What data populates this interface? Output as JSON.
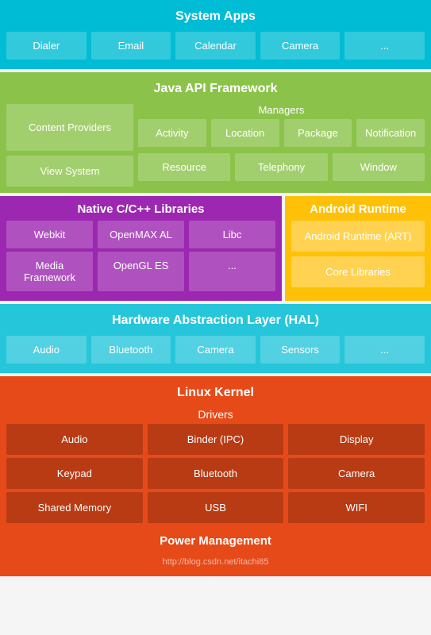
{
  "systemApps": {
    "title": "System Apps",
    "items": [
      "Dialer",
      "Email",
      "Calendar",
      "Camera",
      "..."
    ]
  },
  "javaAPI": {
    "title": "Java API Framework",
    "contentProviders": "Content Providers",
    "viewSystem": "View System",
    "managersTitle": "Managers",
    "managersRow1": [
      "Activity",
      "Location",
      "Package",
      "Notification"
    ],
    "managersRow2": [
      "Resource",
      "Telephony",
      "Window"
    ]
  },
  "nativeCpp": {
    "title": "Native C/C++ Libraries",
    "row1": [
      "Webkit",
      "OpenMAX AL",
      "Libc"
    ],
    "row2": [
      "Media Framework",
      "OpenGL ES",
      "..."
    ]
  },
  "androidRuntime": {
    "title": "Android Runtime",
    "item1": "Android Runtime (ART)",
    "item2": "Core Libraries"
  },
  "hal": {
    "title": "Hardware Abstraction Layer (HAL)",
    "items": [
      "Audio",
      "Bluetooth",
      "Camera",
      "Sensors",
      "..."
    ]
  },
  "linuxKernel": {
    "title": "Linux Kernel",
    "driversTitle": "Drivers",
    "row1": [
      "Audio",
      "Binder (IPC)",
      "Display"
    ],
    "row2": [
      "Keypad",
      "Bluetooth",
      "Camera"
    ],
    "row3": [
      "Shared Memory",
      "USB",
      "WIFI"
    ],
    "powerMgmt": "Power Management",
    "watermark": "http://blog.csdn.net/itachi85"
  }
}
